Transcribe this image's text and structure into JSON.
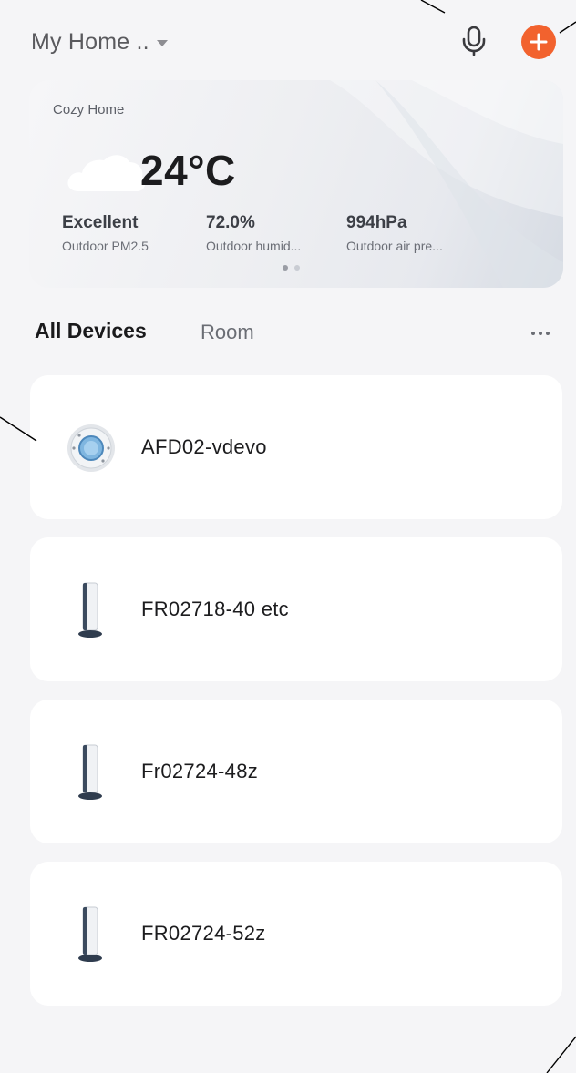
{
  "header": {
    "home_name": "My Home ..",
    "accent_color": "#f2622e"
  },
  "weather": {
    "location": "Cozy Home",
    "temperature": "24°C",
    "stats": [
      {
        "value": "Excellent",
        "label": "Outdoor PM2.5"
      },
      {
        "value": "72.0%",
        "label": "Outdoor humid..."
      },
      {
        "value": "994hPa",
        "label": "Outdoor air pre..."
      }
    ],
    "page_count": 2,
    "active_page": 1
  },
  "tabs": {
    "all_devices": "All Devices",
    "room": "Room"
  },
  "devices": [
    {
      "name": "AFD02-vdevo",
      "icon": "thermostat-icon"
    },
    {
      "name": "FR02718-40 etc",
      "icon": "tower-fan-icon"
    },
    {
      "name": "Fr02724-48z",
      "icon": "tower-fan-icon"
    },
    {
      "name": "FR02724-52z",
      "icon": "tower-fan-icon"
    }
  ]
}
